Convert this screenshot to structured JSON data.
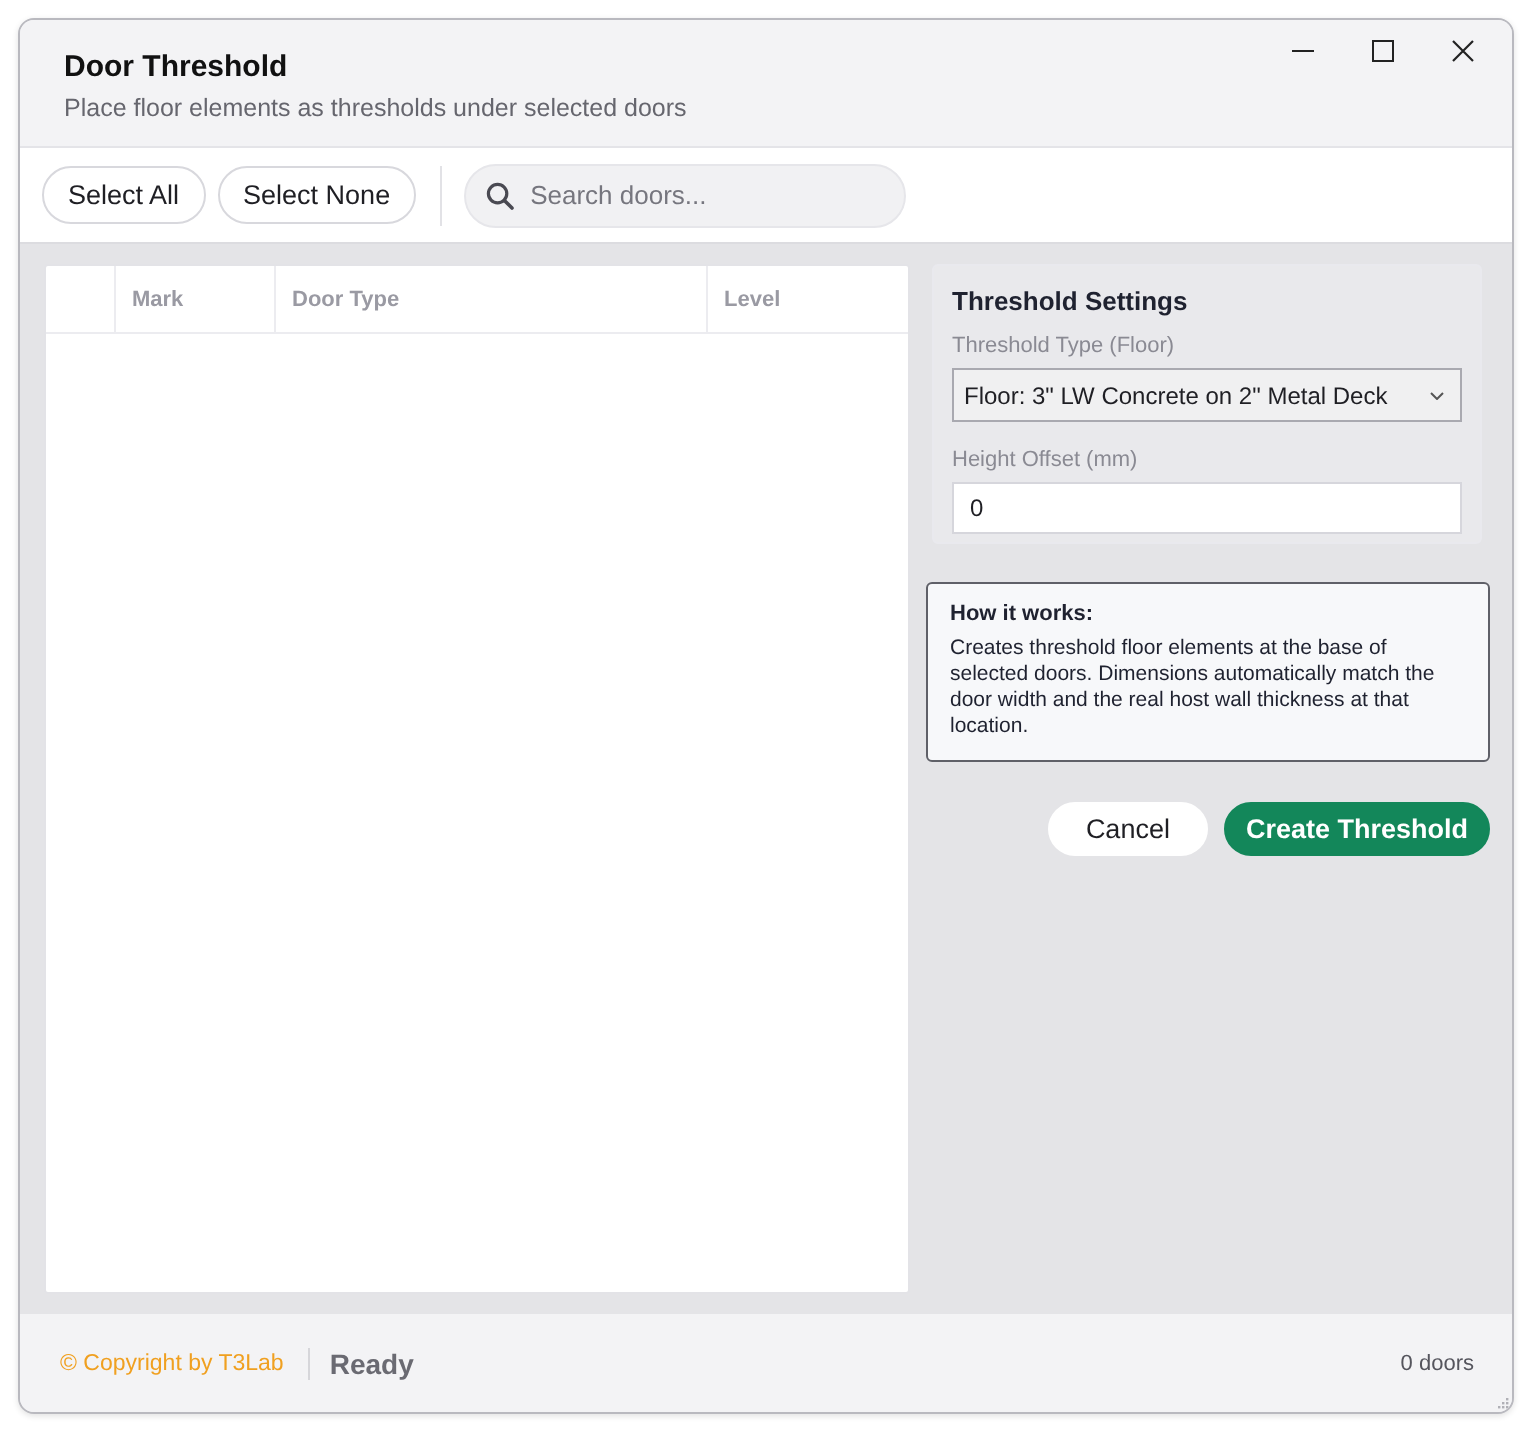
{
  "window": {
    "title": "Door Threshold",
    "subtitle": "Place floor elements as thresholds under selected doors"
  },
  "toolbar": {
    "buttons": [
      "Select All",
      "Select None"
    ],
    "search": {
      "placeholder": "Search doors..."
    }
  },
  "table": {
    "columns": [
      "Mark",
      "Door Type",
      "Level"
    ]
  },
  "settings": {
    "title": "Threshold Settings",
    "fields": [
      {
        "kind": "select",
        "label": "Threshold Type (Floor)",
        "value": "Floor: 3\" LW Concrete on 2\" Metal Deck"
      },
      {
        "kind": "input",
        "label": "Height Offset (mm)",
        "value": "0"
      }
    ]
  },
  "info": {
    "title": "How it works:",
    "text": "Creates threshold floor elements at the base of selected doors. Dimensions automatically match the door width and the real host wall thickness at that location."
  },
  "actions": [
    {
      "kind": "secondary",
      "label": "Cancel"
    },
    {
      "kind": "primary",
      "label": "Create Threshold"
    }
  ],
  "status_bar": {
    "copyright": "© Copyright by T3Lab",
    "status": "Ready",
    "count": "0 doors"
  }
}
